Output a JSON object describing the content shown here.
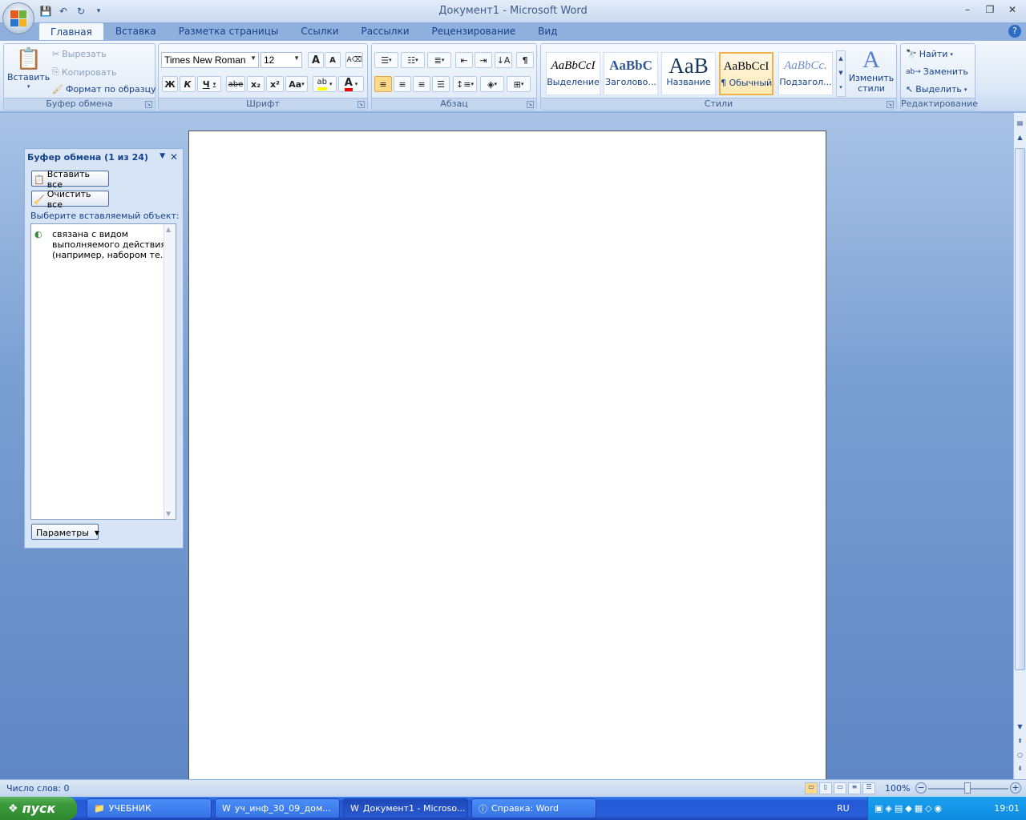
{
  "window": {
    "title": "Документ1 - Microsoft Word"
  },
  "tabs": [
    {
      "label": "Главная",
      "active": true
    },
    {
      "label": "Вставка"
    },
    {
      "label": "Разметка страницы"
    },
    {
      "label": "Ссылки"
    },
    {
      "label": "Рассылки"
    },
    {
      "label": "Рецензирование"
    },
    {
      "label": "Вид"
    }
  ],
  "clipboard_group": {
    "label": "Буфер обмена",
    "paste": "Вставить",
    "cut": "Вырезать",
    "copy": "Копировать",
    "format_painter": "Формат по образцу"
  },
  "font_group": {
    "label": "Шрифт",
    "font_name": "Times New Roman",
    "font_size": "12",
    "bold": "Ж",
    "italic": "К",
    "underline": "Ч",
    "strike": "abe",
    "subscript": "x₂",
    "superscript": "x²",
    "change_case": "Aa",
    "grow": "A",
    "shrink": "A"
  },
  "paragraph_group": {
    "label": "Абзац",
    "show_marks": "¶"
  },
  "styles_group": {
    "label": "Стили",
    "styles": [
      {
        "sample": "AaBbCcI",
        "name": "Выделение"
      },
      {
        "sample": "AaBbC",
        "name": "Заголово..."
      },
      {
        "sample": "AaB",
        "name": "Название"
      },
      {
        "sample": "AaBbCcI",
        "name": "¶ Обычный",
        "active": true
      },
      {
        "sample": "AaBbCc.",
        "name": "Подзагол..."
      }
    ],
    "change_styles": "Изменить стили"
  },
  "editing_group": {
    "label": "Редактирование",
    "find": "Найти",
    "replace": "Заменить",
    "select": "Выделить"
  },
  "clipboard_pane": {
    "title": "Буфер обмена (1 из 24)",
    "paste_all": "Вставить все",
    "clear_all": "Очистить все",
    "prompt": "Выберите вставляемый объект:",
    "item_text": "связана с видом выполняемого действия (например, набором те...",
    "options": "Параметры"
  },
  "status": {
    "word_count": "Число слов: 0",
    "zoom": "100%"
  },
  "taskbar": {
    "start": "пуск",
    "tasks": [
      {
        "label": "УЧЕБНИК"
      },
      {
        "label": "уч_инф_30_09_дом..."
      },
      {
        "label": "Документ1 - Microso...",
        "active": true
      },
      {
        "label": "Справка: Word"
      }
    ],
    "lang": "RU",
    "time": "19:01"
  },
  "colors": {
    "highlight": "#ffff00",
    "font_color": "#ff0000",
    "accent": "#15428b"
  }
}
